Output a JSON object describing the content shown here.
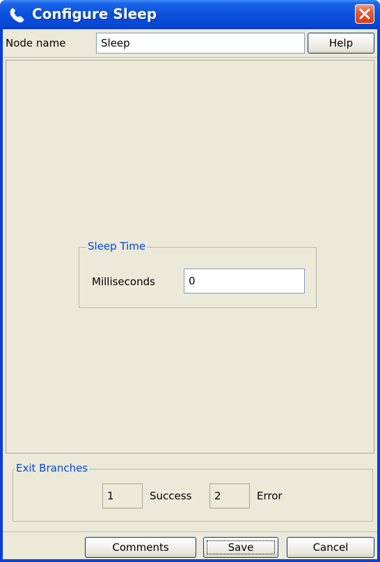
{
  "window": {
    "title": "Configure Sleep",
    "title_icon": "phone-handset-icon",
    "close_icon": "close-icon"
  },
  "node": {
    "label": "Node name",
    "value": "Sleep",
    "help_label": "Help"
  },
  "sleep_time": {
    "legend": "Sleep Time",
    "milliseconds_label": "Milliseconds",
    "milliseconds_value": "0"
  },
  "exit_branches": {
    "legend": "Exit Branches",
    "items": [
      {
        "number": "1",
        "label": "Success"
      },
      {
        "number": "2",
        "label": "Error"
      }
    ]
  },
  "buttons": {
    "comments": "Comments",
    "save": "Save",
    "cancel": "Cancel"
  },
  "colors": {
    "titlebar": "#0a50db",
    "background": "#ece9d8",
    "legend_text": "#0046d5",
    "close_button": "#e2572f"
  }
}
